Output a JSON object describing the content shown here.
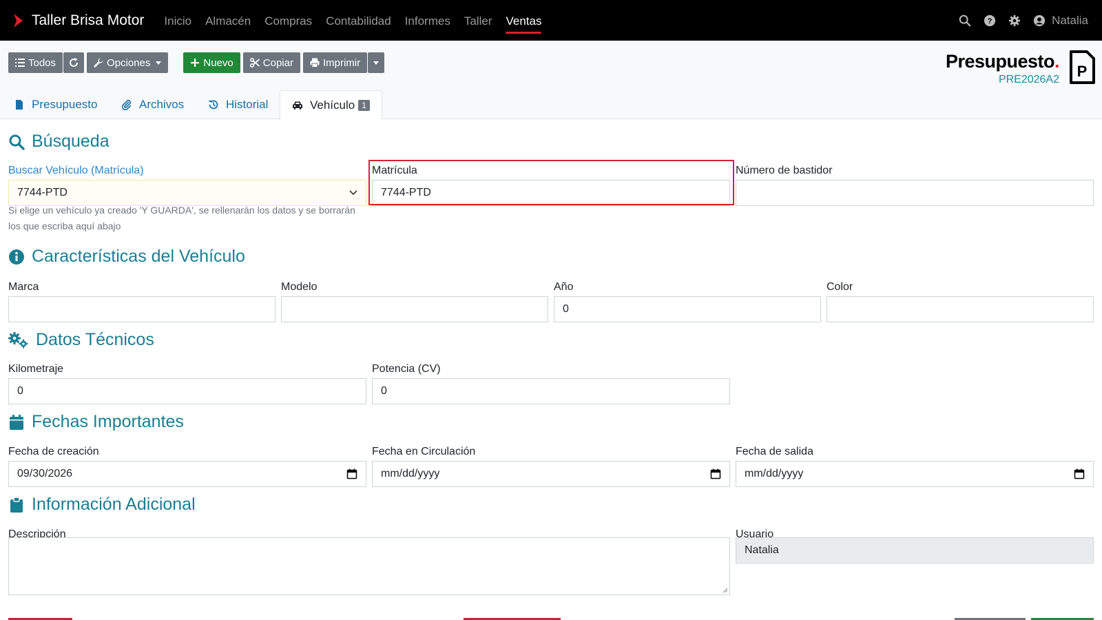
{
  "app": {
    "name": "Taller Brisa Motor"
  },
  "nav": {
    "items": [
      "Inicio",
      "Almacén",
      "Compras",
      "Contabilidad",
      "Informes",
      "Taller",
      "Ventas"
    ],
    "active": "Ventas"
  },
  "user": {
    "name": "Natalia"
  },
  "toolbar": {
    "all_label": "Todos",
    "options_label": "Opciones",
    "new_label": "Nuevo",
    "copy_label": "Copiar",
    "print_label": "Imprimir"
  },
  "document": {
    "title": "Presupuesto",
    "title_dot": ".",
    "code": "PRE2026A2"
  },
  "tabs": [
    {
      "label": "Presupuesto"
    },
    {
      "label": "Archivos"
    },
    {
      "label": "Historial"
    },
    {
      "label": "Vehículo",
      "badge": "1"
    }
  ],
  "search": {
    "heading": "Búsqueda",
    "vehicle_label": "Buscar Vehículo (Matrícula)",
    "vehicle_value": "7744-PTD",
    "help": "Si elige un vehículo ya creado 'Y GUARDA', se rellenarán los datos y se borrarán los que escriba aquí abajo",
    "plate_label": "Matrícula",
    "plate_value": "7744-PTD",
    "vin_label": "Número de bastidor",
    "vin_value": ""
  },
  "characteristics": {
    "heading": "Características del Vehículo",
    "brand_label": "Marca",
    "brand_value": "",
    "model_label": "Modelo",
    "model_value": "",
    "year_label": "Año",
    "year_value": "0",
    "color_label": "Color",
    "color_value": ""
  },
  "technical": {
    "heading": "Datos Técnicos",
    "mileage_label": "Kilometraje",
    "mileage_value": "0",
    "power_label": "Potencia (CV)",
    "power_value": "0"
  },
  "dates": {
    "heading": "Fechas Importantes",
    "created_label": "Fecha de creación",
    "created_value": "09/30/2026",
    "circulation_label": "Fecha en Circulación",
    "circulation_value": "mm/dd/yyyy",
    "exit_label": "Fecha de salida",
    "exit_value": "mm/dd/yyyy"
  },
  "additional": {
    "heading": "Información Adicional",
    "description_label": "Descripción",
    "description_value": "",
    "user_label": "Usuario",
    "user_value": "Natalia"
  },
  "colors": {
    "accent": "#d9202f",
    "heading": "#1a7e93",
    "link": "#2d86c9",
    "green": "#218838",
    "grey": "#6c757d"
  }
}
